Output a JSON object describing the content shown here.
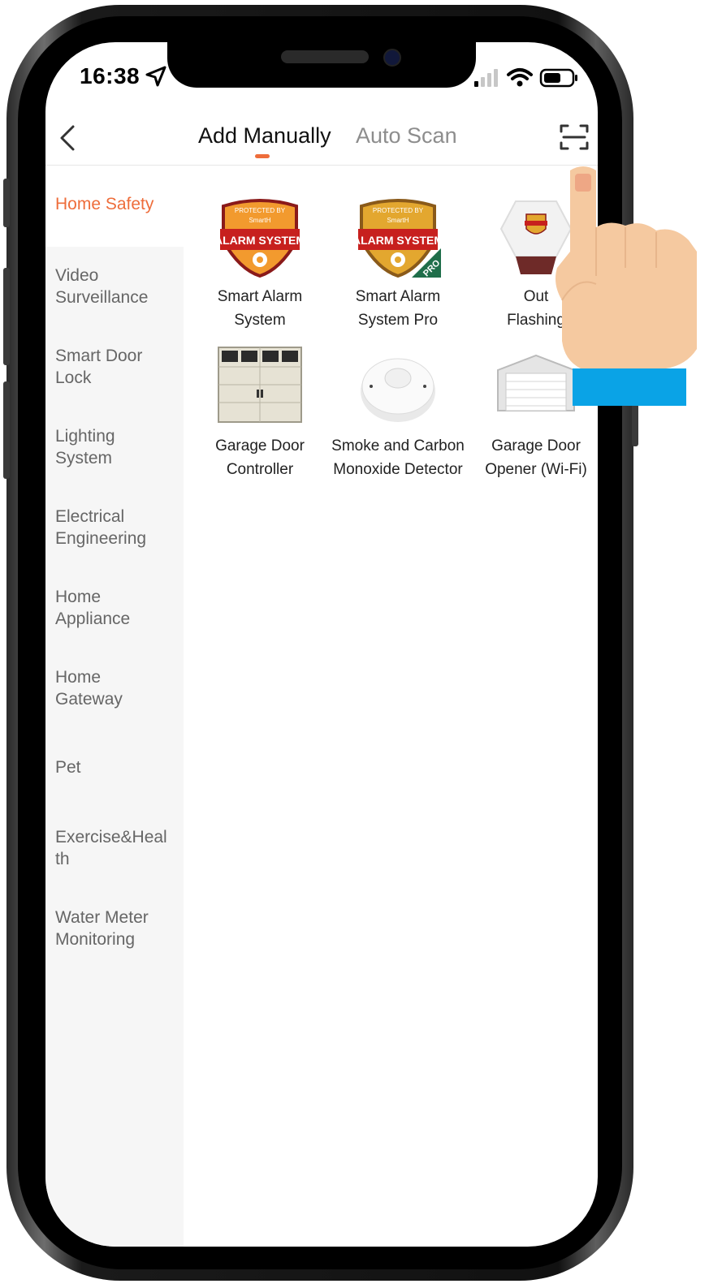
{
  "status_bar": {
    "time": "16:38"
  },
  "nav": {
    "tabs": [
      {
        "label": "Add Manually",
        "active": true
      },
      {
        "label": "Auto Scan",
        "active": false
      }
    ]
  },
  "sidebar": {
    "items": [
      {
        "label": "Home Safety",
        "active": true
      },
      {
        "label": "Video Surveillance"
      },
      {
        "label": "Smart Door Lock"
      },
      {
        "label": "Lighting System"
      },
      {
        "label": "Electrical Engineering"
      },
      {
        "label": "Home Appliance"
      },
      {
        "label": "Home Gateway"
      },
      {
        "label": "Pet"
      },
      {
        "label": "Exercise&Health"
      },
      {
        "label": "Water Meter Monitoring"
      }
    ]
  },
  "devices": [
    {
      "label": "Smart Alarm System",
      "icon": "alarm-system-badge-icon",
      "badge_top": "PROTECTED BY",
      "badge_brand": "SmartH",
      "badge_text": "ALARM SYSTEM"
    },
    {
      "label": "Smart Alarm System Pro",
      "icon": "alarm-system-pro-badge-icon",
      "badge_top": "PROTECTED BY",
      "badge_brand": "SmartH",
      "badge_text": "ALARM SYSTEM",
      "pro_text": "PRO"
    },
    {
      "label_visible_1": "Out",
      "label_visible_2": "Flashing",
      "icon": "outdoor-siren-icon"
    },
    {
      "label": "Garage Door Controller",
      "icon": "garage-door-controller-icon"
    },
    {
      "label": "Smoke and Carbon Monoxide Detector",
      "icon": "smoke-detector-icon"
    },
    {
      "label": "Garage Door Opener (Wi-Fi)",
      "icon": "garage-door-opener-icon"
    }
  ],
  "colors": {
    "accent": "#ee6d3b",
    "sidebar_bg": "#f6f6f6",
    "hand_skin": "#f5c9a0",
    "cuff": "#0aa3e6"
  }
}
